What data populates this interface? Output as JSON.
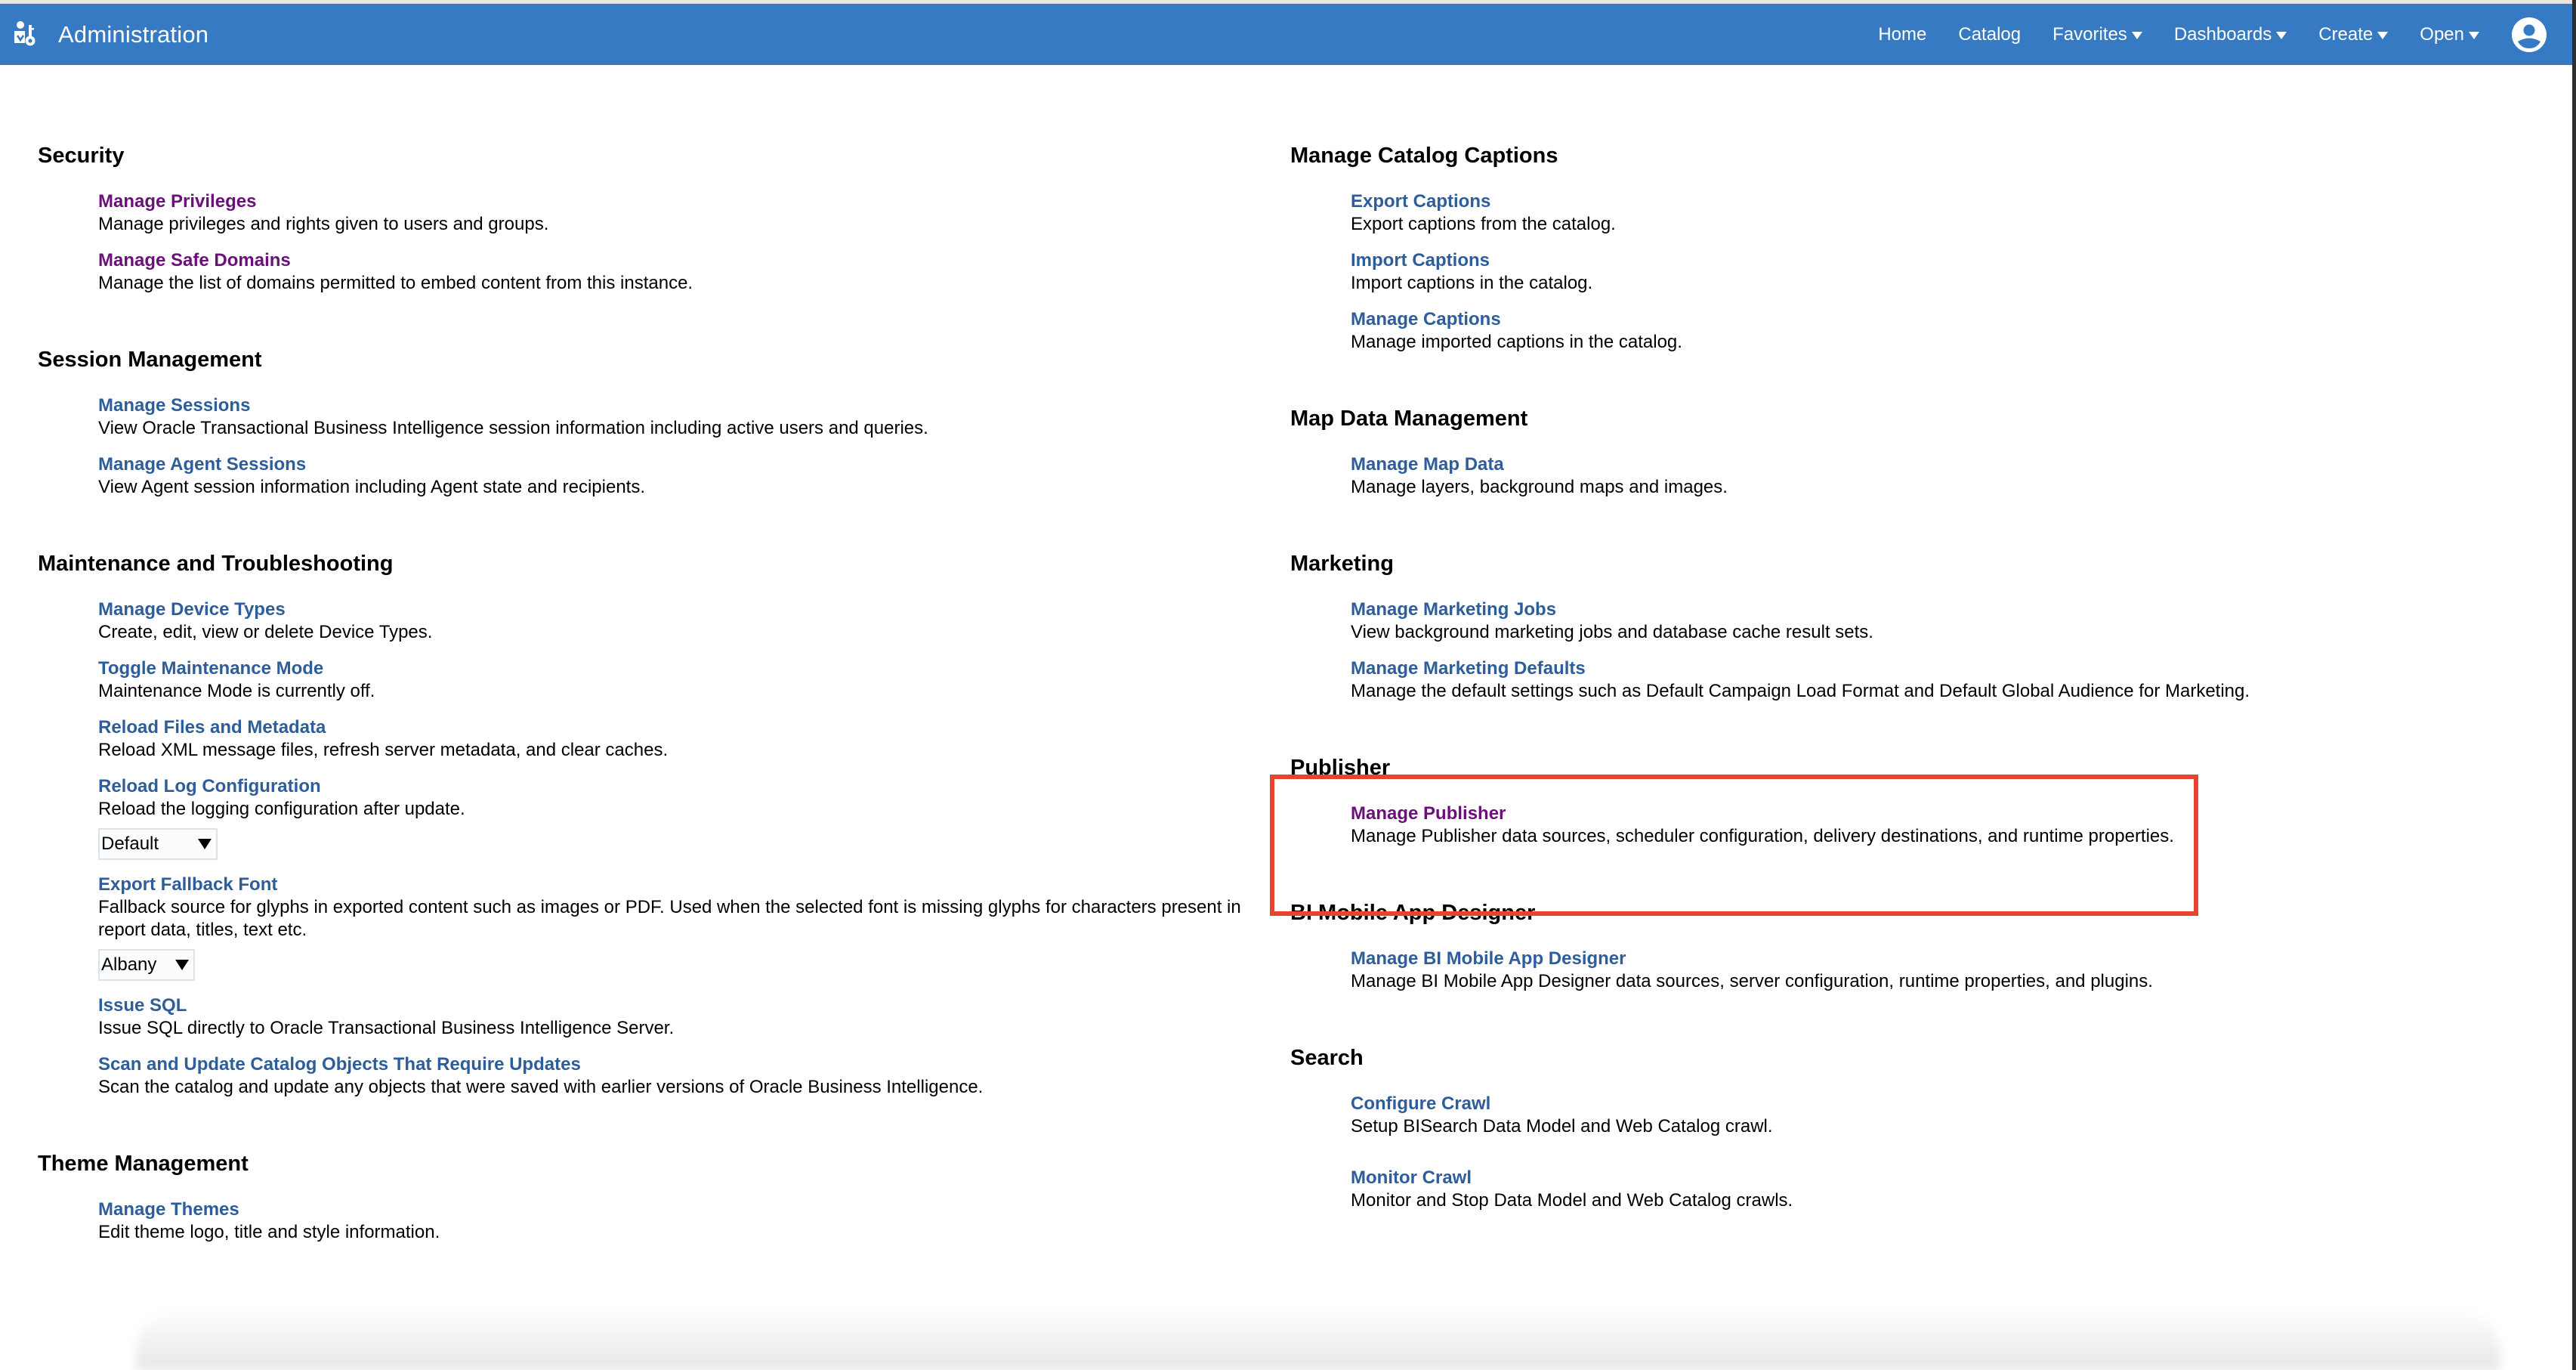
{
  "header": {
    "title": "Administration",
    "logo_icon": "admin-user-key-icon",
    "nav": [
      {
        "label": "Home",
        "has_dropdown": false
      },
      {
        "label": "Catalog",
        "has_dropdown": false
      },
      {
        "label": "Favorites",
        "has_dropdown": true
      },
      {
        "label": "Dashboards",
        "has_dropdown": true
      },
      {
        "label": "Create",
        "has_dropdown": true
      },
      {
        "label": "Open",
        "has_dropdown": true
      }
    ],
    "user_icon": "user-avatar-icon"
  },
  "colors": {
    "header_bg": "#357ac3",
    "link": "#2d5d9a",
    "visited_link": "#6b0f7a",
    "highlight": "#e8432e"
  },
  "left": {
    "security": {
      "title": "Security",
      "items": [
        {
          "label": "Manage Privileges",
          "desc": "Manage privileges and rights given to users and groups."
        },
        {
          "label": "Manage Safe Domains",
          "desc": "Manage the list of domains permitted to embed content from this instance."
        }
      ]
    },
    "session": {
      "title": "Session Management",
      "items": [
        {
          "label": "Manage Sessions",
          "desc": "View Oracle Transactional Business Intelligence session information including active users and queries."
        },
        {
          "label": "Manage Agent Sessions",
          "desc": "View Agent session information including Agent state and recipients."
        }
      ]
    },
    "maintenance": {
      "title": "Maintenance and Troubleshooting",
      "items": [
        {
          "label": "Manage Device Types",
          "desc": "Create, edit, view or delete Device Types."
        },
        {
          "label": "Toggle Maintenance Mode",
          "desc": "Maintenance Mode is currently off."
        },
        {
          "label": "Reload Files and Metadata",
          "desc": "Reload XML message files, refresh server metadata, and clear caches."
        },
        {
          "label": "Reload Log Configuration",
          "desc": "Reload the logging configuration after update.",
          "select_value": "Default"
        },
        {
          "label": "Export Fallback Font",
          "desc": "Fallback source for glyphs in exported content such as images or PDF. Used when the selected font is missing glyphs for characters present in report data, titles, text etc.",
          "select_value": "Albany"
        },
        {
          "label": "Issue SQL",
          "desc": "Issue SQL directly to Oracle Transactional Business Intelligence Server."
        },
        {
          "label": "Scan and Update Catalog Objects That Require Updates",
          "desc": "Scan the catalog and update any objects that were saved with earlier versions of Oracle Business Intelligence."
        }
      ]
    },
    "theme": {
      "title": "Theme Management",
      "items": [
        {
          "label": "Manage Themes",
          "desc": "Edit theme logo, title and style information."
        }
      ]
    }
  },
  "right": {
    "captions": {
      "title": "Manage Catalog Captions",
      "items": [
        {
          "label": "Export Captions",
          "desc": "Export captions from the catalog."
        },
        {
          "label": "Import Captions",
          "desc": "Import captions in the catalog."
        },
        {
          "label": "Manage Captions",
          "desc": "Manage imported captions in the catalog."
        }
      ]
    },
    "map": {
      "title": "Map Data Management",
      "items": [
        {
          "label": "Manage Map Data",
          "desc": "Manage layers, background maps and images."
        }
      ]
    },
    "marketing": {
      "title": "Marketing",
      "items": [
        {
          "label": "Manage Marketing Jobs",
          "desc": "View background marketing jobs and database cache result sets."
        },
        {
          "label": "Manage Marketing Defaults",
          "desc": "Manage the default settings such as Default Campaign Load Format and Default Global Audience for Marketing."
        }
      ]
    },
    "publisher": {
      "title": "Publisher",
      "items": [
        {
          "label": "Manage Publisher",
          "desc": "Manage Publisher data sources, scheduler configuration, delivery destinations, and runtime properties."
        }
      ]
    },
    "mobile": {
      "title": "BI Mobile App Designer",
      "items": [
        {
          "label": "Manage BI Mobile App Designer",
          "desc": "Manage BI Mobile App Designer data sources, server configuration, runtime properties, and plugins."
        }
      ]
    },
    "search": {
      "title": "Search",
      "items": [
        {
          "label": "Configure Crawl",
          "desc": "Setup BISearch Data Model and Web Catalog crawl."
        },
        {
          "label": "Monitor Crawl",
          "desc": "Monitor and Stop Data Model and Web Catalog crawls."
        }
      ]
    }
  }
}
